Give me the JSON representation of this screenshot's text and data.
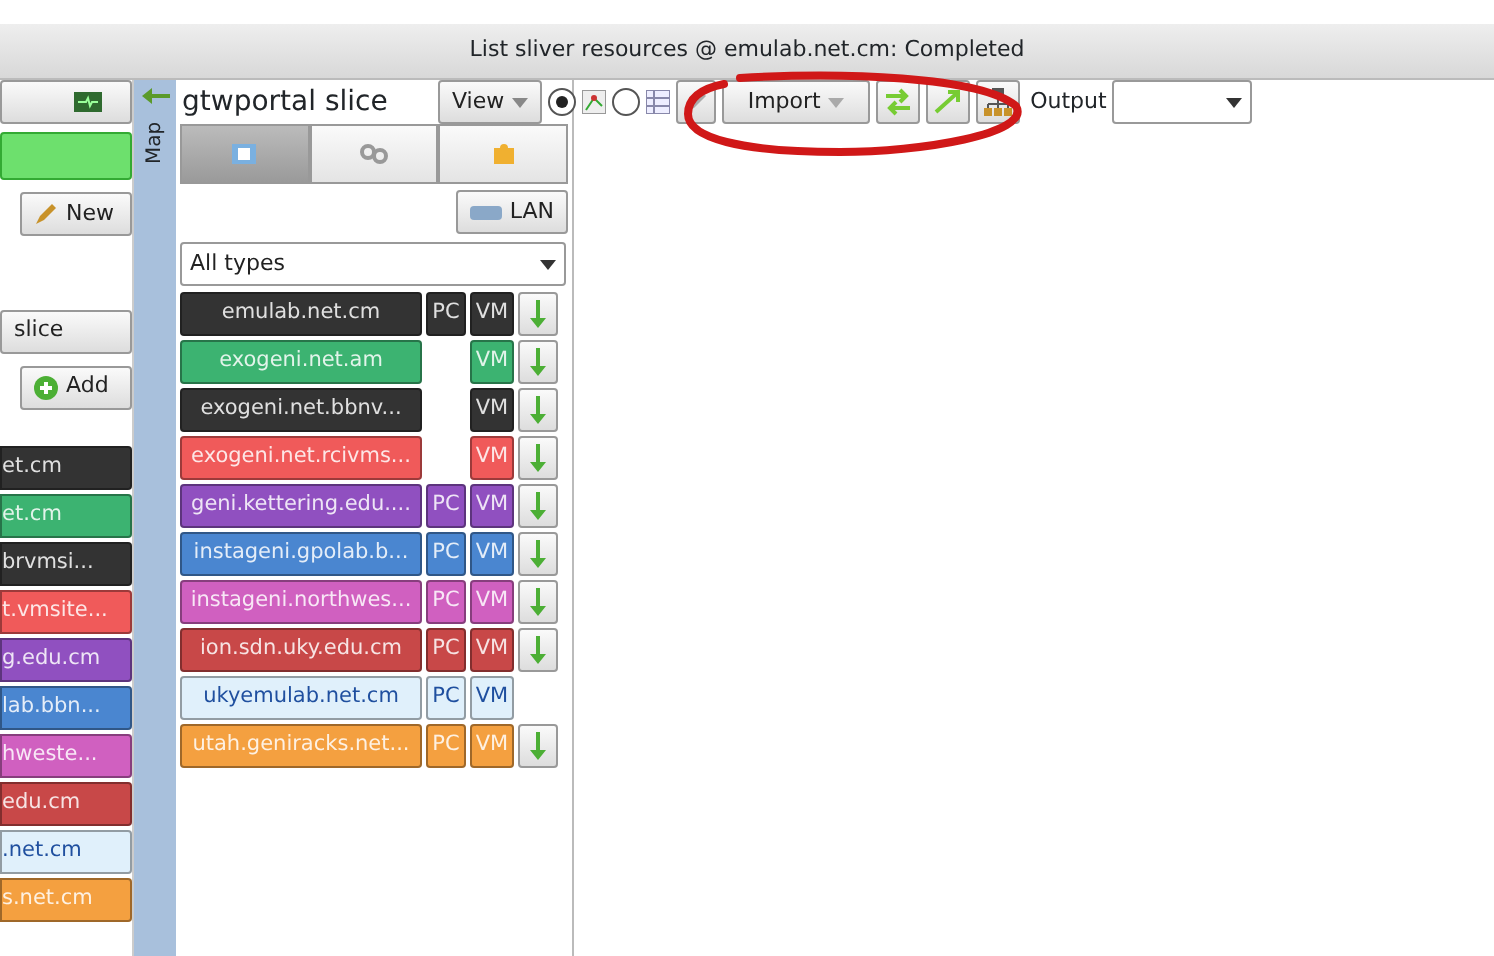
{
  "status_bar": {
    "text": "List sliver resources @ emulab.net.cm: Completed"
  },
  "left_panel": {
    "new_button": "New",
    "slice_button": "slice",
    "add_button": "Add",
    "managers": [
      {
        "label": "et.cm",
        "color": "#333333"
      },
      {
        "label": "et.cm",
        "color": "#3cb371"
      },
      {
        "label": "brvmsi...",
        "color": "#333333"
      },
      {
        "label": "t.vmsite...",
        "color": "#f05a5a"
      },
      {
        "label": "g.edu.cm",
        "color": "#9050c0"
      },
      {
        "label": "lab.bbn...",
        "color": "#4a86d0"
      },
      {
        "label": "hweste...",
        "color": "#d060c0"
      },
      {
        "label": "edu.cm",
        "color": "#c84848"
      },
      {
        "label": ".net.cm",
        "color": "#e0f0fb"
      },
      {
        "label": "s.net.cm",
        "color": "#f4a040"
      }
    ]
  },
  "map_tab": {
    "label": "Map"
  },
  "toolbar": {
    "slice_name": "gtwportal slice",
    "view_button": "View",
    "view_modes": [
      {
        "kind": "graph",
        "selected": true
      },
      {
        "kind": "list",
        "selected": false
      }
    ],
    "import_button": "Import",
    "output_label": "Output"
  },
  "resource_tabs": [
    {
      "kind": "nodes",
      "selected": true
    },
    {
      "kind": "links",
      "selected": false
    },
    {
      "kind": "extras",
      "selected": false
    }
  ],
  "lan_button": "LAN",
  "type_filter": "All types",
  "managers": [
    {
      "name": "emulab.net.cm",
      "color": "#333333",
      "pc": "PC",
      "vm": "VM",
      "download": true
    },
    {
      "name": "exogeni.net.am",
      "color": "#3cb371",
      "vm": "VM",
      "download": true
    },
    {
      "name": "exogeni.net.bbnv...",
      "color": "#333333",
      "vm": "VM",
      "download": true
    },
    {
      "name": "exogeni.net.rcivms...",
      "color": "#f05a5a",
      "vm": "VM",
      "download": true
    },
    {
      "name": "geni.kettering.edu....",
      "color": "#9050c0",
      "pc": "PC",
      "vm": "VM",
      "download": true
    },
    {
      "name": "instageni.gpolab.b...",
      "color": "#4a86d0",
      "pc": "PC",
      "vm": "VM",
      "download": true
    },
    {
      "name": "instageni.northwes...",
      "color": "#d060c0",
      "pc": "PC",
      "vm": "VM",
      "download": true
    },
    {
      "name": "ion.sdn.uky.edu.cm",
      "color": "#c84848",
      "pc": "PC",
      "vm": "VM",
      "download": true
    },
    {
      "name": "ukyemulab.net.cm",
      "color": "#e0f0fb",
      "pc": "PC",
      "vm": "VM",
      "download": false
    },
    {
      "name": "utah.geniracks.net...",
      "color": "#f4a040",
      "pc": "PC",
      "vm": "VM",
      "download": true
    }
  ]
}
